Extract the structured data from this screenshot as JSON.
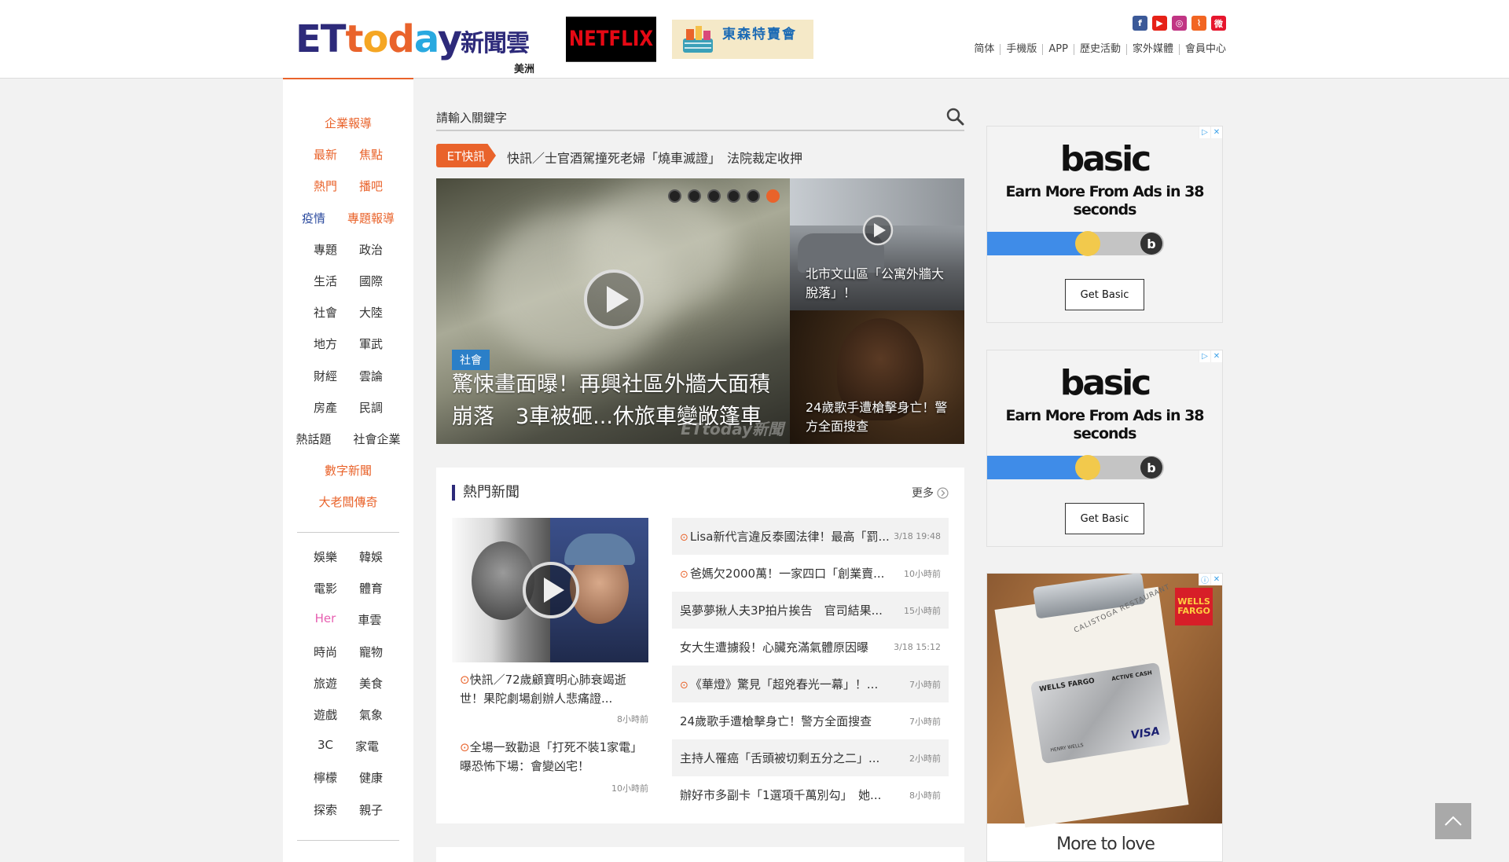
{
  "header": {
    "logo_text": "ETtoday",
    "logo_cn": "新聞雲",
    "logo_sub": "美洲",
    "netflix": "NETFLIX",
    "tokyu": "東森特賣會",
    "social": [
      {
        "name": "facebook-icon",
        "color": "#3b5998",
        "glyph": "f"
      },
      {
        "name": "youtube-icon",
        "color": "#e62117",
        "glyph": "▶"
      },
      {
        "name": "instagram-icon",
        "color": "#c13584",
        "glyph": "◎"
      },
      {
        "name": "rss-icon",
        "color": "#f26522",
        "glyph": "⌇"
      },
      {
        "name": "weibo-icon",
        "color": "#e6162d",
        "glyph": "微"
      }
    ],
    "links": [
      "简体",
      "手機版",
      "APP",
      "歷史活動",
      "家外媒體",
      "會員中心"
    ]
  },
  "nav": {
    "rows": [
      [
        {
          "t": "企業報導",
          "c": "orange"
        }
      ],
      [
        {
          "t": "最新",
          "c": "orange"
        },
        {
          "t": "焦點",
          "c": "orange"
        }
      ],
      [
        {
          "t": "熱門",
          "c": "orange"
        },
        {
          "t": "播吧",
          "c": "orange"
        }
      ],
      [
        {
          "t": "疫情",
          "c": "blue"
        },
        {
          "t": "專題報導",
          "c": "orange"
        }
      ],
      [
        {
          "t": "專題",
          "c": ""
        },
        {
          "t": "政治",
          "c": ""
        }
      ],
      [
        {
          "t": "生活",
          "c": ""
        },
        {
          "t": "國際",
          "c": ""
        }
      ],
      [
        {
          "t": "社會",
          "c": ""
        },
        {
          "t": "大陸",
          "c": ""
        }
      ],
      [
        {
          "t": "地方",
          "c": ""
        },
        {
          "t": "軍武",
          "c": ""
        }
      ],
      [
        {
          "t": "財經",
          "c": ""
        },
        {
          "t": "雲論",
          "c": ""
        }
      ],
      [
        {
          "t": "房產",
          "c": ""
        },
        {
          "t": "民調",
          "c": ""
        }
      ],
      [
        {
          "t": "熱話題",
          "c": ""
        },
        {
          "t": "社會企業",
          "c": ""
        }
      ],
      [
        {
          "t": "數字新聞",
          "c": "orange"
        }
      ],
      [
        {
          "t": "大老闆傳奇",
          "c": "orange"
        }
      ]
    ],
    "rows2": [
      [
        {
          "t": "娛樂",
          "c": ""
        },
        {
          "t": "韓娛",
          "c": ""
        }
      ],
      [
        {
          "t": "電影",
          "c": ""
        },
        {
          "t": "體育",
          "c": ""
        }
      ],
      [
        {
          "t": "Her",
          "c": "pink"
        },
        {
          "t": "車雲",
          "c": ""
        }
      ],
      [
        {
          "t": "時尚",
          "c": ""
        },
        {
          "t": "寵物",
          "c": ""
        }
      ],
      [
        {
          "t": "旅遊",
          "c": ""
        },
        {
          "t": "美食",
          "c": ""
        }
      ],
      [
        {
          "t": "遊戲",
          "c": ""
        },
        {
          "t": "氣象",
          "c": ""
        }
      ],
      [
        {
          "t": "3C",
          "c": ""
        },
        {
          "t": "家電",
          "c": ""
        }
      ],
      [
        {
          "t": "檸檬",
          "c": ""
        },
        {
          "t": "健康",
          "c": ""
        }
      ],
      [
        {
          "t": "探索",
          "c": ""
        },
        {
          "t": "親子",
          "c": ""
        }
      ]
    ]
  },
  "search": {
    "placeholder": "請輸入關鍵字"
  },
  "ticker": {
    "badge": "ET快訊",
    "text": "快訊／士官酒駕撞死老婦「燒車滅證」　法院裁定收押"
  },
  "hero": {
    "tag": "社會",
    "title": "驚悚畫面曝！再興社區外牆大面積崩落　3車被砸...休旅車變敞篷車",
    "watermark": "ETtoday新聞",
    "dots": 6,
    "active_dot": 5
  },
  "side": [
    {
      "title": "北市文山區「公寓外牆大脫落」！"
    },
    {
      "title": "24歲歌手遭槍擊身亡！警方全面搜查"
    }
  ],
  "hot": {
    "title": "熱門新聞",
    "more": "更多",
    "stories": [
      {
        "title": "快訊／72歲顧寶明心肺衰竭逝世！果陀劇場創辦人悲痛證...",
        "time": "8小時前"
      },
      {
        "title": "全場一致勸退「打死不裝1家電」　曝恐怖下場：會變凶宅！",
        "time": "10小時前"
      }
    ],
    "list": [
      {
        "title": "Lisa新代言違反泰國法律！最高「罰...",
        "time": "3/18 19:48",
        "video": true,
        "shade": true
      },
      {
        "title": "爸媽欠2000萬！一家四口「創業賣...",
        "time": "10小時前",
        "video": true,
        "shade": false
      },
      {
        "title": "吳夢夢揪人夫3P拍片挨告　官司結果...",
        "time": "15小時前",
        "video": false,
        "shade": true
      },
      {
        "title": "女大生遭擄殺！心臟充滿氣體原因曝",
        "time": "3/18 15:12",
        "video": false,
        "shade": false
      },
      {
        "title": "《華燈》驚見「超兇春光一幕」！...",
        "time": "7小時前",
        "video": true,
        "shade": true
      },
      {
        "title": "24歲歌手遭槍擊身亡！警方全面搜查",
        "time": "7小時前",
        "video": false,
        "shade": false
      },
      {
        "title": "主持人罹癌「舌頭被切剩五分之二」...",
        "time": "2小時前",
        "video": false,
        "shade": true
      },
      {
        "title": "辦好市多副卡「1選項千萬別勾」　她...",
        "time": "8小時前",
        "video": false,
        "shade": false
      }
    ]
  },
  "ads": {
    "basic": {
      "brand": "basic",
      "headline": "Earn More From Ads in 38 seconds",
      "cta": "Get Basic"
    },
    "wells": {
      "logo": "WELLS FARGO",
      "card_name": "WELLS FARGO",
      "card_type": "ACTIVE CASH",
      "network": "VISA",
      "holder": "HENRY WELLS",
      "receipt": "CALISTOGA RESTAURANT",
      "footer": "More to love"
    }
  }
}
